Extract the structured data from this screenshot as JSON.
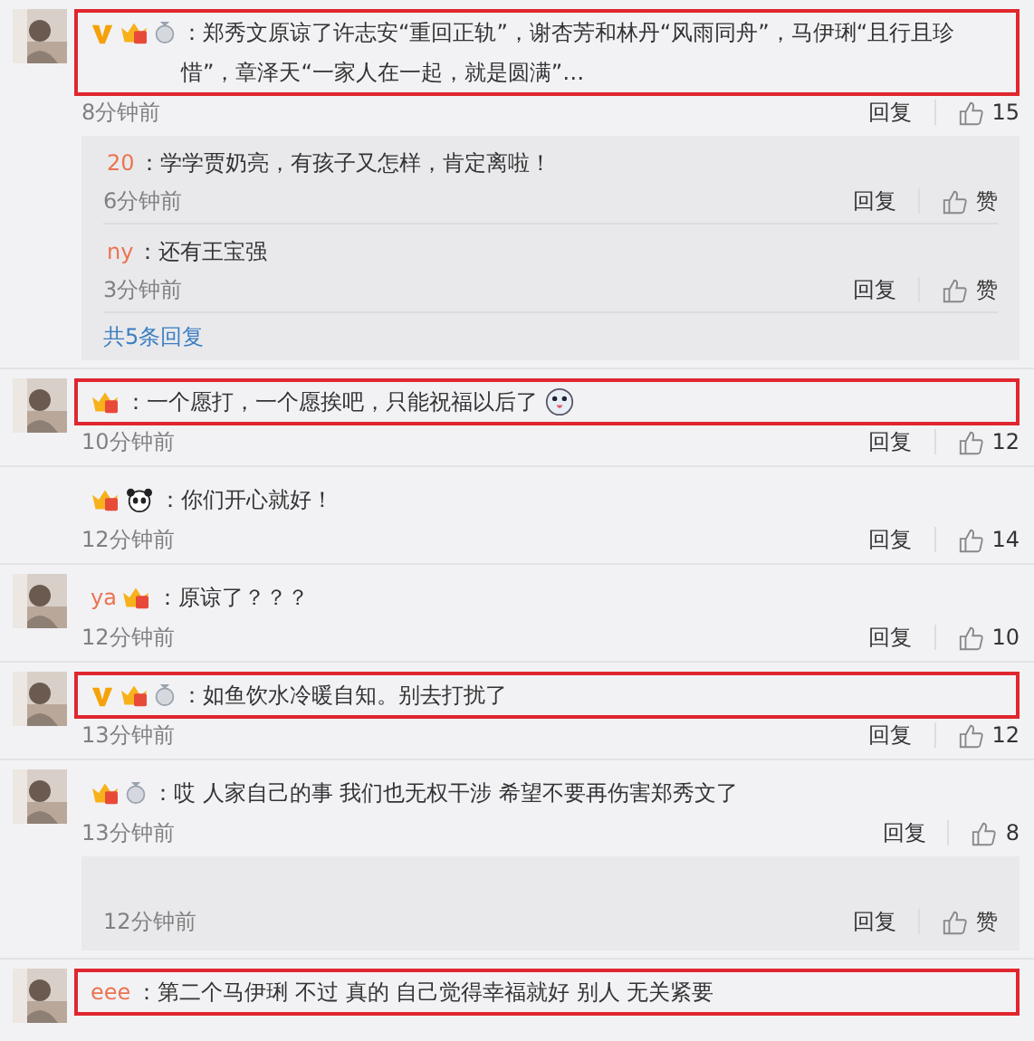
{
  "comments": [
    {
      "avatar": {
        "kind": "picture"
      },
      "verified": true,
      "vip": true,
      "medal": true,
      "text": "：郑秀文原谅了许志安“重回正轨”，谢杏芳和林丹“风雨同舟”，马伊琍“且行且珍惜”，章泽天“一家人在一起，就是圆满”…",
      "highlighted": true,
      "time": "8分钟前",
      "reply": "回复",
      "likes": "15",
      "replies": [
        {
          "name_tail": "20",
          "text": "：学学贾奶亮，有孩子又怎样，肯定离啦！",
          "time": "6分钟前",
          "reply": "回复",
          "likes": "赞"
        },
        {
          "name_tail": "ny",
          "text": "：还有王宝强",
          "time": "3分钟前",
          "reply": "回复",
          "likes": "赞"
        }
      ],
      "more": "共5条回复"
    },
    {
      "avatar": {
        "kind": "picture"
      },
      "vip": true,
      "text": "：一个愿打，一个愿挨吧，只能祝福以后了",
      "trailing_emoji": true,
      "highlighted": true,
      "time": "10分钟前",
      "reply": "回复",
      "likes": "12"
    },
    {
      "vip": true,
      "panda": true,
      "text": "：你们开心就好！",
      "highlighted": false,
      "time": "12分钟前",
      "reply": "回复",
      "likes": "14"
    },
    {
      "avatar": {
        "kind": "picture"
      },
      "name_tail": "ya",
      "vip": true,
      "text": "：原谅了？？？",
      "highlighted": false,
      "time": "12分钟前",
      "reply": "回复",
      "likes": "10"
    },
    {
      "avatar": {
        "kind": "picture"
      },
      "verified": true,
      "vip": true,
      "medal": true,
      "text": "：如鱼饮水冷暖自知。别去打扰了",
      "highlighted": true,
      "time": "13分钟前",
      "reply": "回复",
      "likes": "12"
    },
    {
      "avatar": {
        "kind": "picture"
      },
      "vip": true,
      "medal": true,
      "text": "：哎 人家自己的事 我们也无权干涉 希望不要再伤害郑秀文了",
      "highlighted": false,
      "time": "13分钟前",
      "reply": "回复",
      "likes": "8",
      "replies": [
        {
          "time": "12分钟前",
          "reply": "回复",
          "likes": "赞"
        }
      ]
    },
    {
      "avatar": {
        "kind": "picture"
      },
      "name_tail": "eee",
      "text": "：第二个马伊琍 不过 真的 自己觉得幸福就好 别人 无关紧要",
      "highlighted": true
    }
  ]
}
